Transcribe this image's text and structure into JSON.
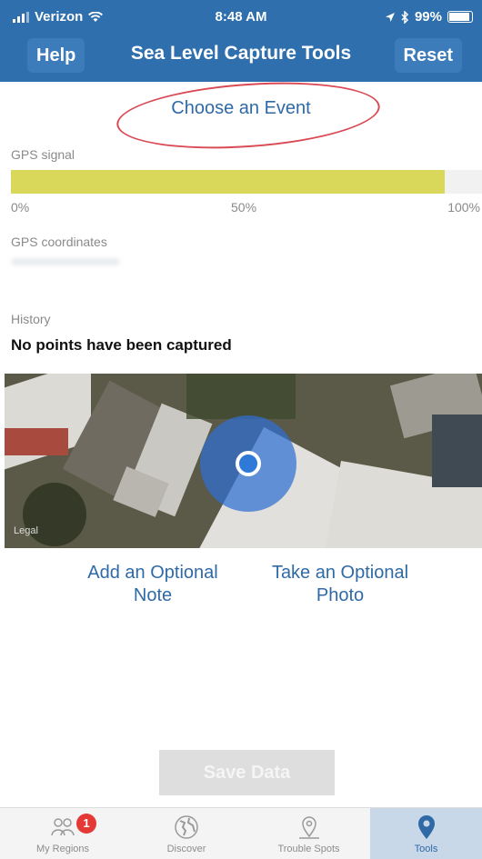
{
  "status_bar": {
    "carrier": "Verizon",
    "time": "8:48 AM",
    "battery": "99%"
  },
  "nav": {
    "help_label": "Help",
    "title": "Sea Level Capture Tools",
    "reset_label": "Reset"
  },
  "event": {
    "label": "Choose an Event"
  },
  "gps_signal": {
    "label": "GPS signal",
    "level_percent": 92,
    "scale_min": "0%",
    "scale_mid": "50%",
    "scale_max": "100%"
  },
  "gps_coordinates": {
    "label": "GPS coordinates"
  },
  "history": {
    "label": "History",
    "text": "No points have been captured"
  },
  "map": {
    "legal": "Legal"
  },
  "actions": {
    "note_line1": "Add an Optional",
    "note_line2": "Note",
    "photo_line1": "Take an Optional",
    "photo_line2": "Photo",
    "save_label": "Save Data"
  },
  "tabs": {
    "my_regions": "My Regions",
    "my_regions_badge": "1",
    "discover": "Discover",
    "trouble_spots": "Trouble Spots",
    "tools": "Tools"
  },
  "colors": {
    "nav": "#2f6fad",
    "link": "#2f6aa6",
    "gps_fill": "#d9d85a",
    "annotation": "#d94a55"
  }
}
